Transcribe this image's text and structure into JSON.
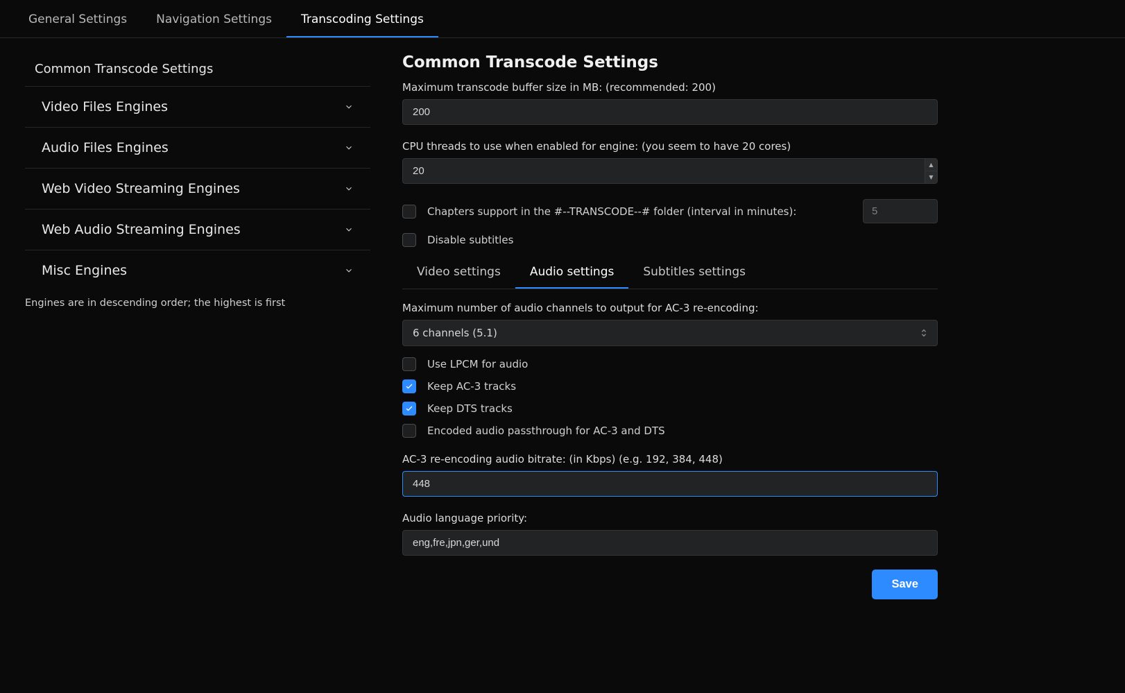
{
  "tabs": {
    "general": "General Settings",
    "navigation": "Navigation Settings",
    "transcoding": "Transcoding Settings"
  },
  "sidebar": {
    "heading": "Common Transcode Settings",
    "items": [
      "Video Files Engines",
      "Audio Files Engines",
      "Web Video Streaming Engines",
      "Web Audio Streaming Engines",
      "Misc Engines"
    ],
    "note": "Engines are in descending order; the highest is first"
  },
  "panel": {
    "title": "Common Transcode Settings",
    "buffer_label": "Maximum transcode buffer size in MB: (recommended: 200)",
    "buffer_value": "200",
    "cpu_label": "CPU threads to use when enabled for engine: (you seem to have 20 cores)",
    "cpu_value": "20",
    "chapters_label": "Chapters support in the #--TRANSCODE--# folder (interval in minutes):",
    "chapters_value": "5",
    "disable_subs_label": "Disable subtitles",
    "subtabs": {
      "video": "Video settings",
      "audio": "Audio settings",
      "subs": "Subtitles settings"
    },
    "audio": {
      "channels_label": "Maximum number of audio channels to output for AC-3 re-encoding:",
      "channels_value": "6 channels (5.1)",
      "lpcm_label": "Use LPCM for audio",
      "keep_ac3_label": "Keep AC-3 tracks",
      "keep_dts_label": "Keep DTS tracks",
      "passthrough_label": "Encoded audio passthrough for AC-3 and DTS",
      "bitrate_label": "AC-3 re-encoding audio bitrate: (in Kbps) (e.g. 192, 384, 448)",
      "bitrate_value": "448",
      "lang_label": "Audio language priority:",
      "lang_value": "eng,fre,jpn,ger,und"
    },
    "save": "Save"
  }
}
